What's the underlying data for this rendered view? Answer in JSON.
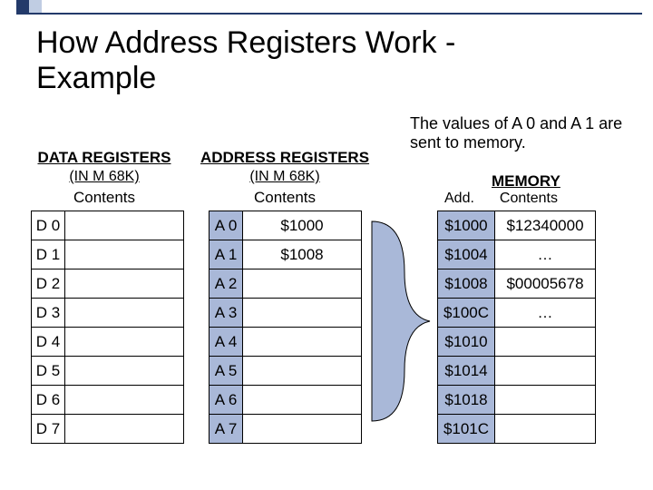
{
  "title_l1": "How Address Registers Work -",
  "title_l2": "Example",
  "annot_l1": "The values of A 0 and A 1 are",
  "annot_l2": "sent to memory.",
  "dataReg": {
    "head": "DATA REGISTERS",
    "sub": "(IN M 68K)",
    "contents": "Contents",
    "rows": [
      "D 0",
      "D 1",
      "D 2",
      "D 3",
      "D 4",
      "D 5",
      "D 6",
      "D 7"
    ]
  },
  "addrReg": {
    "head": "ADDRESS REGISTERS",
    "sub": "(IN M 68K)",
    "contents": "Contents",
    "rows": [
      [
        "A 0",
        "$1000"
      ],
      [
        "A 1",
        "$1008"
      ],
      [
        "A 2",
        ""
      ],
      [
        "A 3",
        ""
      ],
      [
        "A 4",
        ""
      ],
      [
        "A 5",
        ""
      ],
      [
        "A 6",
        ""
      ],
      [
        "A 7",
        ""
      ]
    ]
  },
  "mem": {
    "head": "MEMORY",
    "addLabel": "Add.",
    "contLabel": "Contents",
    "rows": [
      [
        "$1000",
        "$12340000"
      ],
      [
        "$1004",
        "…"
      ],
      [
        "$1008",
        "$00005678"
      ],
      [
        "$100C",
        "…"
      ],
      [
        "$1010",
        ""
      ],
      [
        "$1014",
        ""
      ],
      [
        "$1018",
        ""
      ],
      [
        "$101C",
        ""
      ]
    ]
  }
}
